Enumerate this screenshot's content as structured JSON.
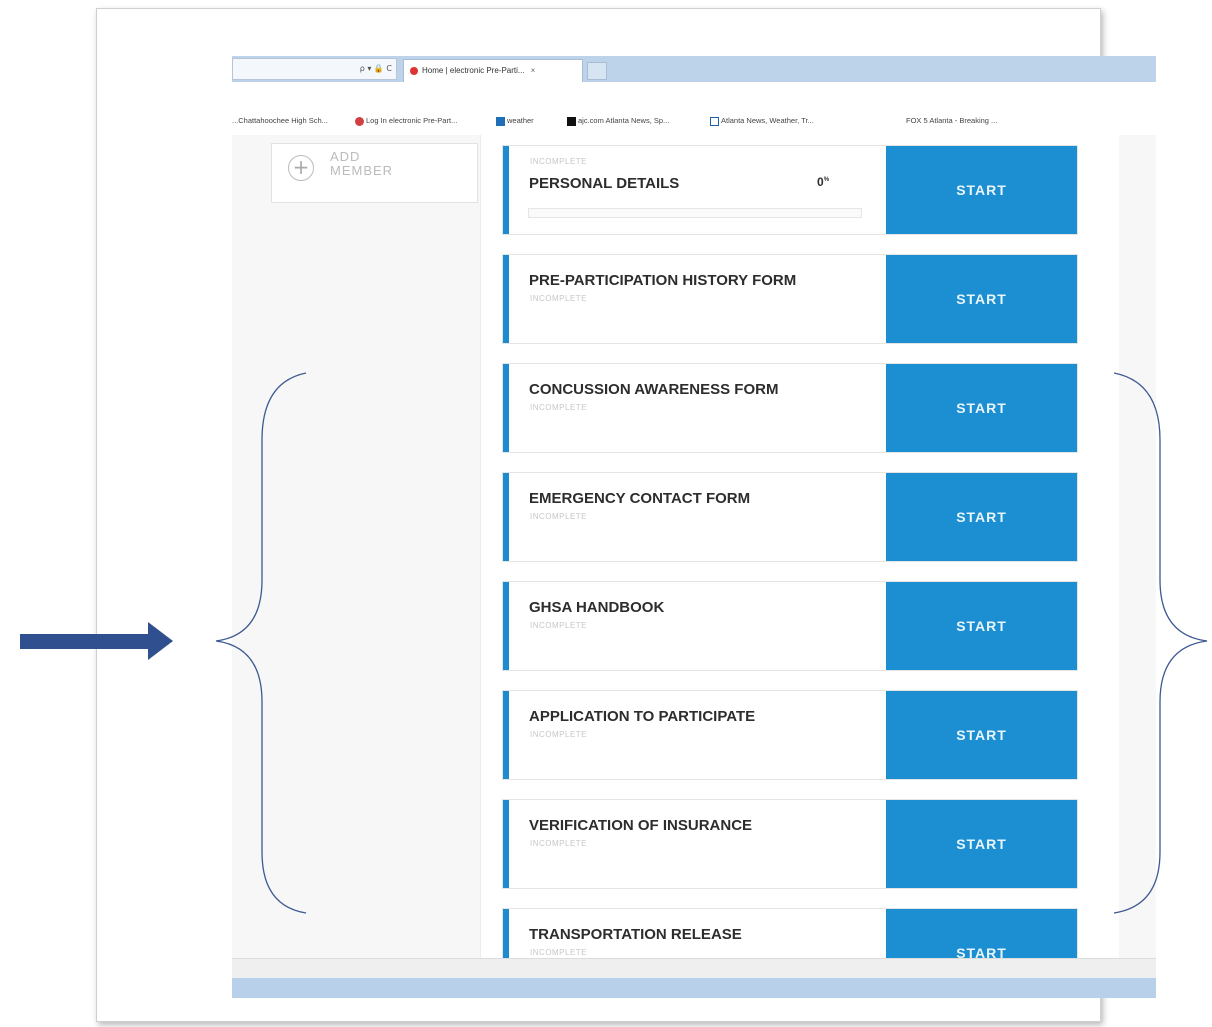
{
  "browser": {
    "address_text": "ρ ▾ 🔒 C",
    "tab_title": "Home | electronic Pre-Parti...",
    "tab_close": "×",
    "favorites": [
      {
        "label": "...Chattahoochee High Sch..."
      },
      {
        "label": "Log In  electronic Pre-Part..."
      },
      {
        "label": "weather"
      },
      {
        "label": "ajc.com Atlanta News, Sp..."
      },
      {
        "label": "Atlanta News, Weather, Tr..."
      },
      {
        "label": "FOX 5 Atlanta - Breaking ..."
      }
    ]
  },
  "sidebar": {
    "add_member_icon": "+",
    "add_member_label": "ADD\nMEMBER"
  },
  "forms": [
    {
      "status": "INCOMPLETE",
      "title": "PERSONAL DETAILS",
      "percent_text": "0",
      "percent_unit": "%",
      "progress": 0,
      "button": "START"
    },
    {
      "title": "PRE-PARTICIPATION HISTORY FORM",
      "status": "INCOMPLETE",
      "button": "START"
    },
    {
      "title": "CONCUSSION AWARENESS FORM",
      "status": "INCOMPLETE",
      "button": "START"
    },
    {
      "title": "EMERGENCY CONTACT FORM",
      "status": "INCOMPLETE",
      "button": "START"
    },
    {
      "title": "GHSA HANDBOOK",
      "status": "INCOMPLETE",
      "button": "START"
    },
    {
      "title": "APPLICATION TO PARTICIPATE",
      "status": "INCOMPLETE",
      "button": "START"
    },
    {
      "title": "VERIFICATION OF INSURANCE",
      "status": "INCOMPLETE",
      "button": "START"
    },
    {
      "title": "TRANSPORTATION RELEASE",
      "status": "INCOMPLETE",
      "button": "START"
    }
  ],
  "colors": {
    "accent": "#1b8fd2",
    "annotation_arrow": "#2f4f8f",
    "annotation_brace": "#3d5a92"
  },
  "annotations": {
    "arrow_icon": "right-arrow-icon",
    "brace_icons": [
      "left-curly-brace-icon",
      "right-curly-brace-icon"
    ]
  }
}
